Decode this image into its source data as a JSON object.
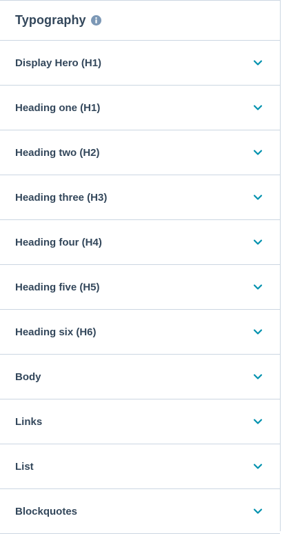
{
  "panel": {
    "title": "Typography",
    "title_icon": "info-icon",
    "sections": [
      {
        "label": "Display Hero (H1)",
        "icon": "chevron-down-icon"
      },
      {
        "label": "Heading one (H1)",
        "icon": "chevron-down-icon"
      },
      {
        "label": "Heading two (H2)",
        "icon": "chevron-down-icon"
      },
      {
        "label": "Heading three (H3)",
        "icon": "chevron-down-icon"
      },
      {
        "label": "Heading four (H4)",
        "icon": "chevron-down-icon"
      },
      {
        "label": "Heading five (H5)",
        "icon": "chevron-down-icon"
      },
      {
        "label": "Heading six (H6)",
        "icon": "chevron-down-icon"
      },
      {
        "label": "Body",
        "icon": "chevron-down-icon"
      },
      {
        "label": "Links",
        "icon": "chevron-down-icon"
      },
      {
        "label": "List",
        "icon": "chevron-down-icon"
      },
      {
        "label": "Blockquotes",
        "icon": "chevron-down-icon"
      }
    ]
  },
  "colors": {
    "text": "#33475b",
    "chevron": "#0091ae",
    "divider": "#cbd6e2",
    "info_icon": "#7c98b6"
  }
}
